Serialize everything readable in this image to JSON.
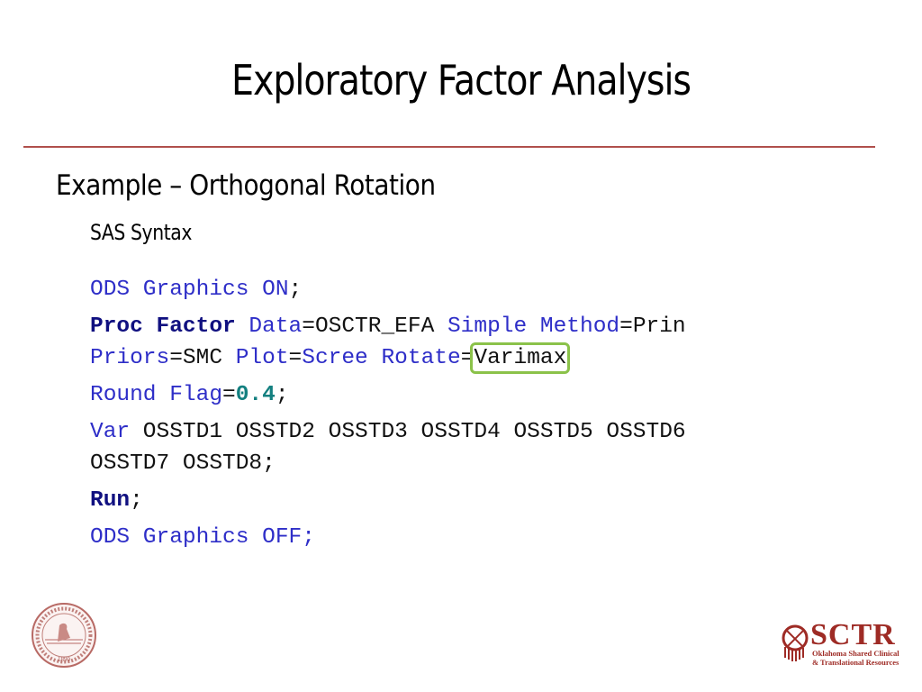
{
  "slide": {
    "title": "Exploratory Factor Analysis",
    "heading": "Example – Orthogonal Rotation",
    "subheading": "SAS Syntax"
  },
  "code": {
    "line1": {
      "kw1": "ODS Graphics ON",
      "semi": ";"
    },
    "line2": {
      "proc": "Proc Factor",
      "data_kw": " Data",
      "eq1": "=OSCTR_EFA ",
      "simple": "Simple Method",
      "eq2": "=Prin"
    },
    "line3": {
      "priors": "Priors",
      "eq1": "=SMC ",
      "plot": "Plot",
      "eq2": "=",
      "scree": "Scree Rotate",
      "eq3": "=",
      "varimax": "Varimax"
    },
    "line4": {
      "round": "Round Flag",
      "eq": "=",
      "flag": "0.4",
      "semi": ";"
    },
    "line5": {
      "var": "Var",
      "vars1": " OSSTD1 OSSTD2 OSSTD3 OSSTD4 OSSTD5 OSSTD6"
    },
    "line6": {
      "vars2": "OSSTD7 OSSTD8;"
    },
    "line7": {
      "run": "Run",
      "semi": ";"
    },
    "line8": {
      "kw": "ODS Graphics OFF;"
    }
  },
  "highlight": {
    "target": "Varimax",
    "color": "#8bc24a"
  },
  "logos": {
    "left": {
      "name": "University of Oklahoma seal",
      "year": "1890"
    },
    "right": {
      "wordmark": "SCTR",
      "line1": "Oklahoma Shared Clinical",
      "line2": "& Translational Resources"
    }
  },
  "colors": {
    "rule": "#b0504c",
    "keyword": "#2e2ec8",
    "proc": "#101080",
    "number": "#138080",
    "brand": "#9e2b25"
  }
}
